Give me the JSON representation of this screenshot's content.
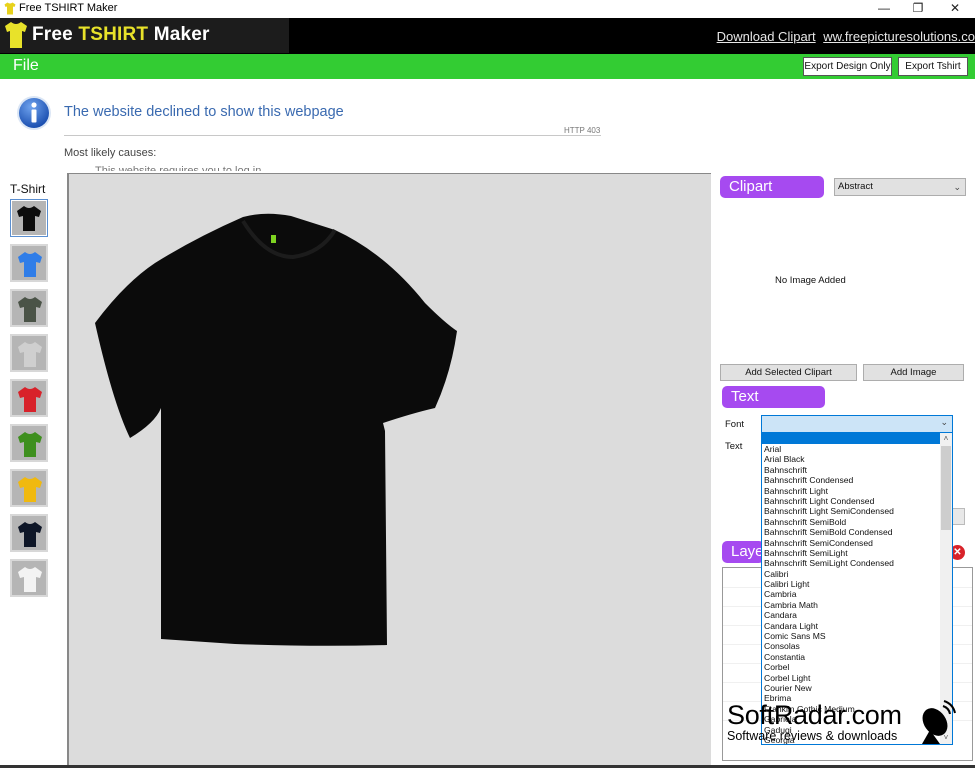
{
  "window": {
    "title": "Free TSHIRT Maker",
    "controls": [
      "minimize",
      "restore",
      "close"
    ]
  },
  "banner": {
    "logo_part1": "Free ",
    "logo_highlight": "TSHIRT",
    "logo_part2": " Maker",
    "link_download": "Download Clipart",
    "link_site": "ww.freepicturesolutions.co"
  },
  "menubar": {
    "file_label": "File",
    "export_design_label": "Export Design Only",
    "export_tshirt_label": "Export Tshirt"
  },
  "web_error": {
    "heading": "The website declined to show this webpage",
    "code": "HTTP 403",
    "causes_label": "Most likely causes:",
    "cut_line": "This website requires you to log in."
  },
  "tshirt_panel": {
    "label": "T-Shirt",
    "swatches": [
      {
        "name": "black",
        "color": "#0d0d0d",
        "selected": true
      },
      {
        "name": "blue",
        "color": "#2f7de8",
        "selected": false
      },
      {
        "name": "dark-grey",
        "color": "#4a5347",
        "selected": false
      },
      {
        "name": "light-grey",
        "color": "#cfcfcf",
        "selected": false
      },
      {
        "name": "red",
        "color": "#d8222a",
        "selected": false
      },
      {
        "name": "green",
        "color": "#3e8f1e",
        "selected": false
      },
      {
        "name": "yellow",
        "color": "#f0b90f",
        "selected": false
      },
      {
        "name": "navy",
        "color": "#0e1627",
        "selected": false
      },
      {
        "name": "white",
        "color": "#f3f3f3",
        "selected": false
      }
    ]
  },
  "canvas": {
    "shirt_color": "#0b0b0b",
    "tag_color": "#7ed321"
  },
  "clipart": {
    "header": "Clipart",
    "category_selected": "Abstract",
    "preview_text": "No Image Added",
    "add_selected_label": "Add Selected Clipart",
    "add_image_label": "Add Image"
  },
  "text_section": {
    "header": "Text",
    "font_label": "Font",
    "text_label": "Text",
    "font_value": ""
  },
  "font_dropdown": {
    "options": [
      "Arial",
      "Arial Black",
      "Bahnschrift",
      "Bahnschrift Condensed",
      "Bahnschrift Light",
      "Bahnschrift Light Condensed",
      "Bahnschrift Light SemiCondensed",
      "Bahnschrift SemiBold",
      "Bahnschrift SemiBold Condensed",
      "Bahnschrift SemiCondensed",
      "Bahnschrift SemiLight",
      "Bahnschrift SemiLight Condensed",
      "Calibri",
      "Calibri Light",
      "Cambria",
      "Cambria Math",
      "Candara",
      "Candara Light",
      "Comic Sans MS",
      "Consolas",
      "Constantia",
      "Corbel",
      "Corbel Light",
      "Courier New",
      "Ebrima",
      "Franklin Gothic Medium",
      "Gabriola",
      "Gadugi",
      "Georgia"
    ]
  },
  "layers": {
    "header": "Layers"
  },
  "watermark": {
    "title": "SoftRadar.com",
    "subtitle": "Software reviews & downloads"
  },
  "colors": {
    "accent_green": "#33cc33",
    "section_purple": "#a64af0",
    "logo_yellow": "#e8e22a",
    "selection_blue": "#0078d7"
  }
}
